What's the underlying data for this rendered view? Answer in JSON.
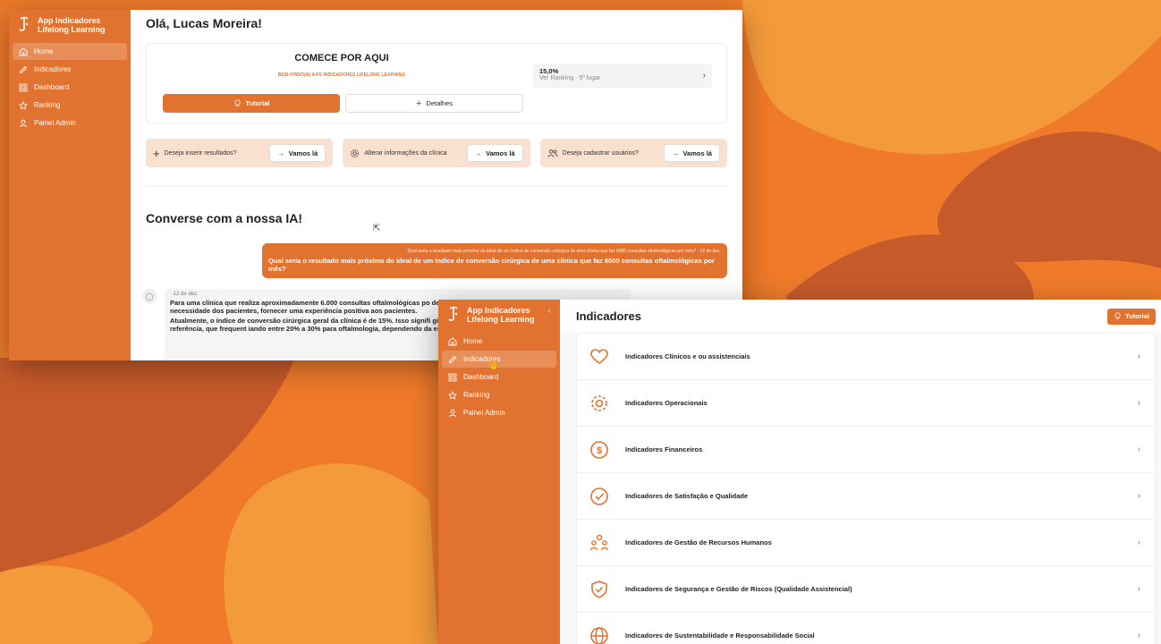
{
  "colors": {
    "accent": "#e27230",
    "background": "#ee7a2a",
    "blob_dark": "#c65a2a",
    "blob_light": "#f39a3a"
  },
  "app": {
    "name_line1": "App Indicadores",
    "name_line2": "Lifelong Learning"
  },
  "sidebar": {
    "items": [
      {
        "label": "Home",
        "icon": "home-icon"
      },
      {
        "label": "Indicadores",
        "icon": "pencil-icon"
      },
      {
        "label": "Dashboard",
        "icon": "grid-icon"
      },
      {
        "label": "Ranking",
        "icon": "star-icon"
      },
      {
        "label": "Painel Admin",
        "icon": "user-icon"
      }
    ],
    "collapse": "‹"
  },
  "home": {
    "greeting": "Olá, Lucas Moreira!",
    "start_title": "COMECE POR AQUI",
    "start_subtitle": "BEM-VINDO(A) AOS INDICADORES LIFELONG LEARNING",
    "tutorial_button": "Tutorial",
    "details_button": "Detalhes",
    "ranking_value": "15,0%",
    "ranking_link": "Ver Ranking · 5º lugar",
    "actions": [
      {
        "label": "Deseja inserir resultados?",
        "button": "Vamos lá",
        "icon": "plus-icon"
      },
      {
        "label": "Alterar informações da clínica",
        "button": "Vamos lá",
        "icon": "gear-icon"
      },
      {
        "label": "Deseja cadastrar usuários?",
        "button": "Vamos lá",
        "icon": "users-icon"
      }
    ],
    "ai_title": "Converse com a nossa IA!",
    "user_meta": "Qual seria o resultado mais próximo do ideal de um índice de conversão cirúrgica de uma clínica que faz 6000 consultas oftalmológicas por mês? · 12 de dez.",
    "user_question": "Qual seria o resultado mais próximo do ideal de um índice de conversão cirúrgica de uma clínica que faz 6000 consultas oftalmológicas por mês?",
    "ai_meta": "· 12 de dez.",
    "ai_para1": "Para uma clínica que realiza aproximadamente 6.000 consultas oftalmológicas po dependendo de vários fatores, como a a escolha e a necessidade dos pacientes, fornecer uma experiência positiva aos pacientes.",
    "ai_para2": "Atualmente, o índice de conversão cirúrgica geral da clínica é de 15%. Isso signifi gias. Um índice ideal pode ser observado em clínicas de referência, que frequent iando entre 20% a 30% para oftalmologia, dependendo da especialidade e do tipo como, etc.)."
  },
  "indicadores": {
    "title": "Indicadores",
    "tutorial_button": "Tutorial",
    "rows": [
      {
        "label": "Indicadores Clínicos e ou assistenciais",
        "icon": "heart-icon"
      },
      {
        "label": "Indicadores Operacionais",
        "icon": "gear-icon"
      },
      {
        "label": "Indicadores Financeiros",
        "icon": "dollar-icon"
      },
      {
        "label": "Indicadores de Satisfação e Qualidade",
        "icon": "check-circle-icon"
      },
      {
        "label": "Indicadores de Gestão de Recursos Humanos",
        "icon": "people-icon"
      },
      {
        "label": "Indicadores de Segurança e Gestão de Riscos (Qualidade Assistencial)",
        "icon": "shield-check-icon"
      },
      {
        "label": "Indicadores de Sustentabilidade e Responsabilidade Social",
        "icon": "globe-icon"
      }
    ]
  }
}
